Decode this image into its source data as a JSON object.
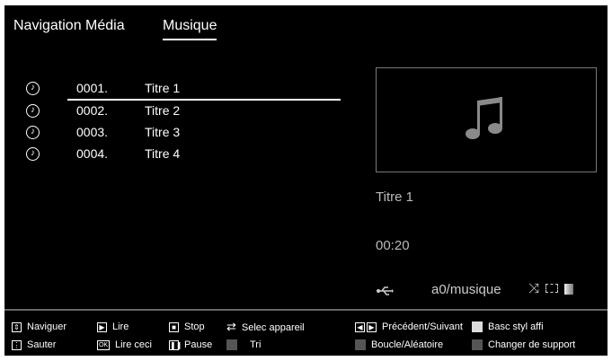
{
  "header": {
    "nav_label": "Navigation Média",
    "active_tab": "Musique"
  },
  "tracks": [
    {
      "number": "0001.",
      "title": "Titre 1"
    },
    {
      "number": "0002.",
      "title": "Titre 2"
    },
    {
      "number": "0003.",
      "title": "Titre 3"
    },
    {
      "number": "0004.",
      "title": "Titre 4"
    }
  ],
  "now_playing": {
    "title": "Titre 1",
    "time": "00:20",
    "path": "a0/musique"
  },
  "legend": {
    "naviguer": "Naviguer",
    "sauter": "Sauter",
    "lire": "Lire",
    "lire_ceci": "Lire ceci",
    "stop": "Stop",
    "pause": "Pause",
    "selec_appareil": "Selec appareil",
    "tri": "Tri",
    "precedent_suivant": "Précédent/Suivant",
    "boucle": "Boucle/Aléatoire",
    "basc_styl": "Basc styl affi",
    "changer_support": "Changer de support",
    "ok_key": "OK"
  },
  "colors": {
    "background": "#000000",
    "text": "#ffffff",
    "muted": "#bbbbbb",
    "grey_key": "#555555",
    "light_key": "#dddddd"
  }
}
